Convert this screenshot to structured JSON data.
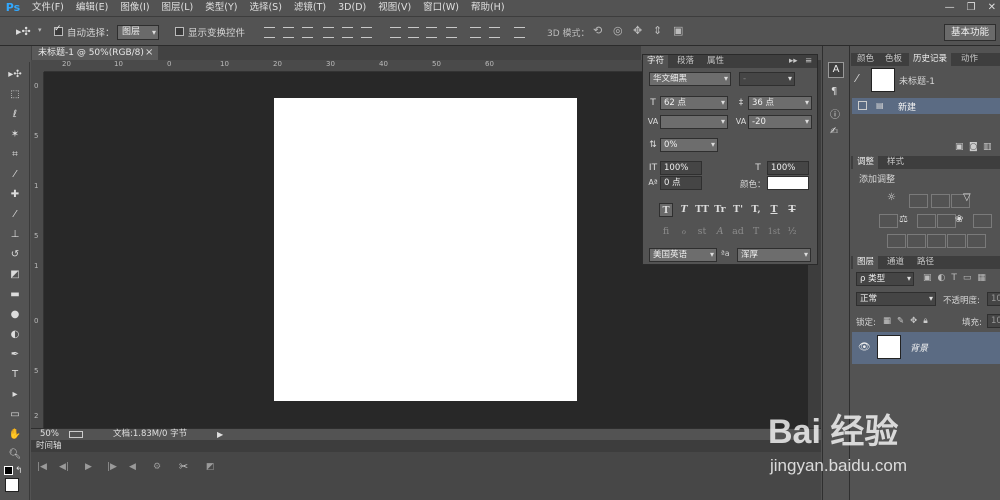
{
  "app": {
    "logo": "Ps"
  },
  "menu": [
    "文件(F)",
    "编辑(E)",
    "图像(I)",
    "图层(L)",
    "类型(Y)",
    "选择(S)",
    "滤镜(T)",
    "3D(D)",
    "视图(V)",
    "窗口(W)",
    "帮助(H)"
  ],
  "window_controls": {
    "minimize": "—",
    "restore": "❐",
    "close": "✕"
  },
  "options": {
    "auto_select_label": "自动选择：",
    "auto_select_value": "图层",
    "show_transform_label": "显示变换控件",
    "mode_3d_label": "3D 模式：",
    "workspace": "基本功能"
  },
  "document": {
    "tab_title": "未标题-1 @ 50%(RGB/8)",
    "close": "×"
  },
  "status": {
    "zoom": "50%",
    "doc_info": "文档:1.83M/0 字节"
  },
  "timeline": {
    "tab": "时间轴"
  },
  "ruler_h": [
    "20",
    "10",
    "0",
    "10",
    "20",
    "30",
    "40",
    "50",
    "60"
  ],
  "ruler_v": [
    "0",
    "5",
    "1",
    "5",
    "1",
    "0",
    "5",
    "2"
  ],
  "character": {
    "tabs": [
      "字符",
      "段落",
      "属性"
    ],
    "font_family": "华文细黑",
    "font_style": "-",
    "font_size": "62 点",
    "leading": "36 点",
    "kerning": "",
    "tracking": "-20",
    "scale": "0%",
    "vertical_scale": "100%",
    "horizontal_scale": "100%",
    "baseline": "0 点",
    "color_label": "颜色：",
    "language": "美国英语",
    "aa_label": "a",
    "aa_value": "浑厚",
    "style_buttons": [
      "T",
      "T",
      "TT",
      "Tr",
      "T'",
      "T,",
      "T",
      "T"
    ],
    "opentype_buttons": [
      "fi",
      "ℴ",
      "st",
      "A",
      "ad",
      "T",
      "1st",
      "½"
    ]
  },
  "history": {
    "tabs": [
      "颜色",
      "色板",
      "历史记录",
      "动作"
    ],
    "snapshot": "未标题-1",
    "items": [
      "新建"
    ]
  },
  "adjustments": {
    "tabs": [
      "调整",
      "样式"
    ],
    "title": "添加调整"
  },
  "layers": {
    "tabs": [
      "图层",
      "通道",
      "路径"
    ],
    "kind": "ρ 类型",
    "blend_mode": "正常",
    "opacity_label": "不透明度:",
    "opacity_value": "10",
    "lock_label": "锁定:",
    "fill_label": "填充:",
    "fill_value": "10",
    "layer_name": "背景"
  },
  "watermark": {
    "brand": "Bai  经验",
    "url": "jingyan.baidu.com"
  },
  "colors": {
    "selection": "#5b6b83",
    "accent": "#31a8ff"
  }
}
